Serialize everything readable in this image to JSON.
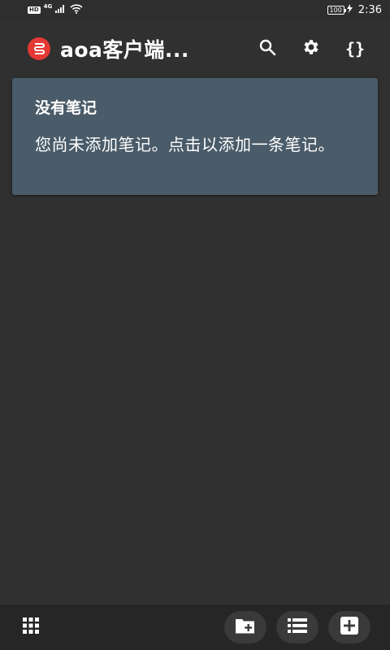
{
  "status_bar": {
    "hd_label": "HD",
    "network_label": "4G",
    "battery_level": "100",
    "time": "2:36"
  },
  "app_bar": {
    "title": "aoa客户端...",
    "logo_color": "#e53935",
    "actions": [
      {
        "name": "search",
        "icon": "search-icon"
      },
      {
        "name": "settings",
        "icon": "gear-icon"
      },
      {
        "name": "code",
        "icon": "braces-icon",
        "label": "{}"
      }
    ]
  },
  "empty_state": {
    "title": "没有笔记",
    "message": "您尚未添加笔记。点击以添加一条笔记。",
    "card_color": "#4a5b69"
  },
  "bottom_bar": {
    "buttons": [
      {
        "name": "apps-grid",
        "icon": "grid-icon"
      },
      {
        "name": "new-folder",
        "icon": "folder-plus-icon"
      },
      {
        "name": "list",
        "icon": "list-icon"
      },
      {
        "name": "add-note",
        "icon": "plus-box-icon"
      }
    ]
  }
}
